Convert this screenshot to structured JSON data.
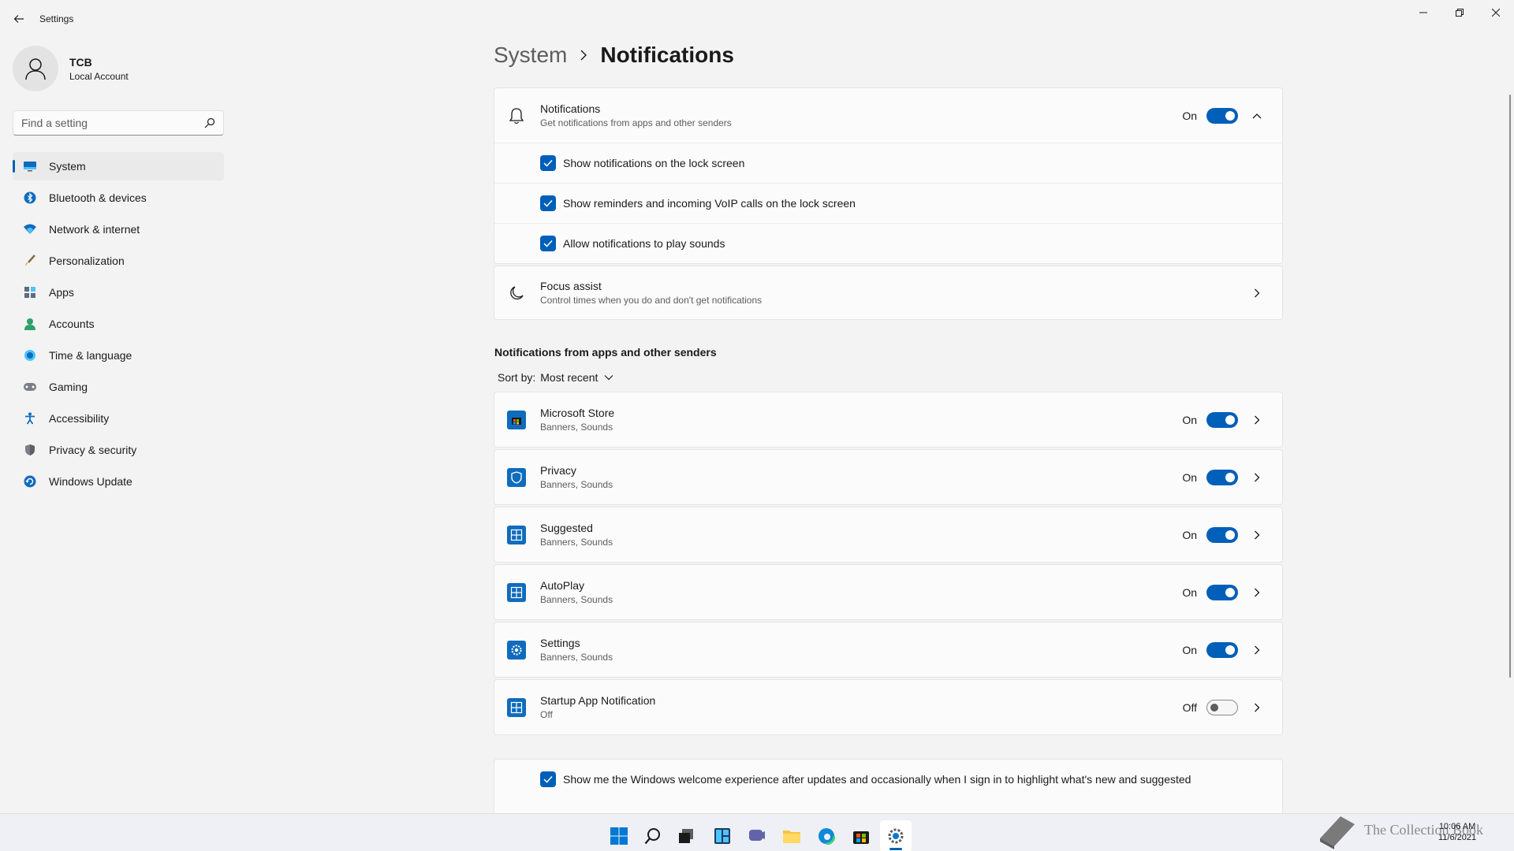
{
  "window": {
    "title": "Settings"
  },
  "profile": {
    "name": "TCB",
    "account_type": "Local Account"
  },
  "search": {
    "placeholder": "Find a setting"
  },
  "nav": {
    "items": [
      {
        "label": "System",
        "icon": "monitor-icon",
        "active": true
      },
      {
        "label": "Bluetooth & devices",
        "icon": "bluetooth-icon"
      },
      {
        "label": "Network & internet",
        "icon": "wifi-icon"
      },
      {
        "label": "Personalization",
        "icon": "brush-icon"
      },
      {
        "label": "Apps",
        "icon": "apps-icon"
      },
      {
        "label": "Accounts",
        "icon": "person-icon"
      },
      {
        "label": "Time & language",
        "icon": "globe-clock-icon"
      },
      {
        "label": "Gaming",
        "icon": "gamepad-icon"
      },
      {
        "label": "Accessibility",
        "icon": "accessibility-icon"
      },
      {
        "label": "Privacy & security",
        "icon": "shield-icon"
      },
      {
        "label": "Windows Update",
        "icon": "update-icon"
      }
    ]
  },
  "breadcrumb": {
    "parent": "System",
    "current": "Notifications"
  },
  "notifications": {
    "title": "Notifications",
    "subtitle": "Get notifications from apps and other senders",
    "state": "On",
    "options": [
      {
        "label": "Show notifications on the lock screen",
        "checked": true
      },
      {
        "label": "Show reminders and incoming VoIP calls on the lock screen",
        "checked": true
      },
      {
        "label": "Allow notifications to play sounds",
        "checked": true
      }
    ]
  },
  "focus_assist": {
    "title": "Focus assist",
    "subtitle": "Control times when you do and don't get notifications"
  },
  "apps_section": {
    "title": "Notifications from apps and other senders",
    "sort_label": "Sort by:",
    "sort_value": "Most recent",
    "apps": [
      {
        "name": "Microsoft Store",
        "detail": "Banners, Sounds",
        "state": "On",
        "on": true,
        "icon": "store-icon"
      },
      {
        "name": "Privacy",
        "detail": "Banners, Sounds",
        "state": "On",
        "on": true,
        "icon": "privacy-shield-icon"
      },
      {
        "name": "Suggested",
        "detail": "Banners, Sounds",
        "state": "On",
        "on": true,
        "icon": "app-grid-icon"
      },
      {
        "name": "AutoPlay",
        "detail": "Banners, Sounds",
        "state": "On",
        "on": true,
        "icon": "app-grid-icon"
      },
      {
        "name": "Settings",
        "detail": "Banners, Sounds",
        "state": "On",
        "on": true,
        "icon": "settings-gear-icon"
      },
      {
        "name": "Startup App Notification",
        "detail": "Off",
        "state": "Off",
        "on": false,
        "icon": "app-grid-icon"
      }
    ]
  },
  "welcome_experience": {
    "label": "Show me the Windows welcome experience after updates and occasionally when I sign in to highlight what's new and suggested",
    "checked": true
  },
  "taskbar": {
    "icons": [
      "start-icon",
      "search-icon",
      "task-view-icon",
      "widgets-icon",
      "chat-icon",
      "file-explorer-icon",
      "edge-icon",
      "store-icon",
      "settings-icon"
    ],
    "time": "10:06 AM",
    "date": "11/6/2021"
  },
  "watermark": {
    "text": "The Collection Book"
  },
  "colors": {
    "accent": "#005fb8",
    "background": "#f3f3f3",
    "card": "#fbfbfb"
  }
}
